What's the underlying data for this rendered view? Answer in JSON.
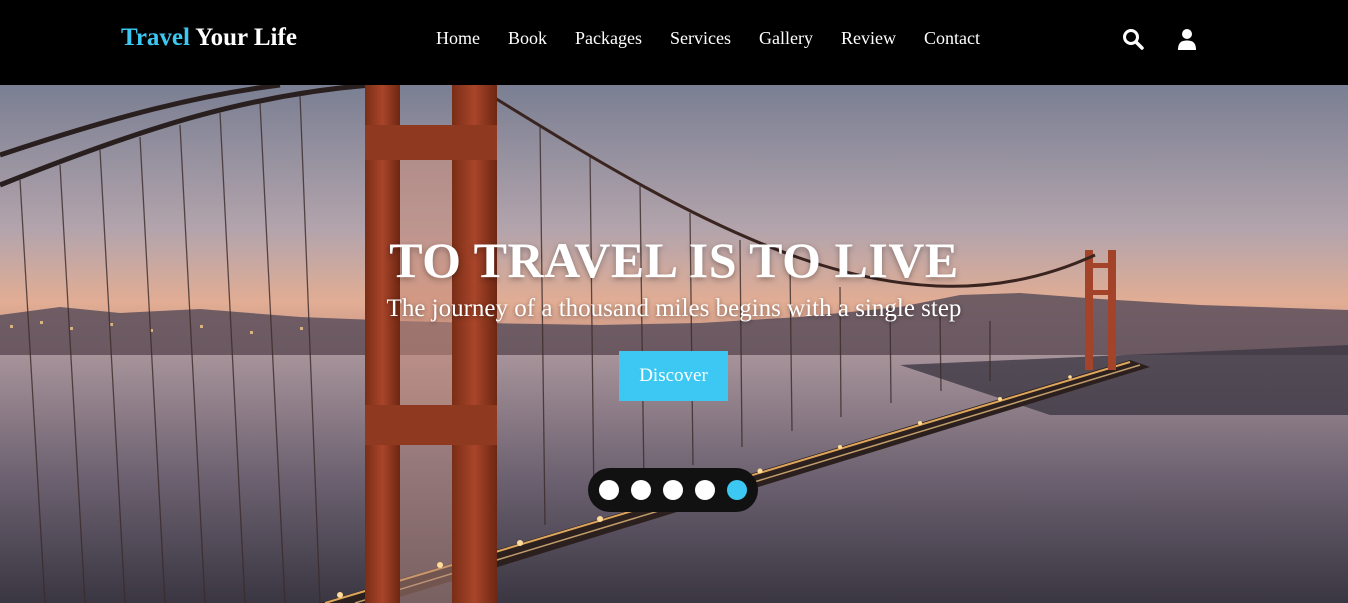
{
  "logo": {
    "part1": "Travel",
    "part2": "Your Life"
  },
  "nav": {
    "links": [
      "Home",
      "Book",
      "Packages",
      "Services",
      "Gallery",
      "Review",
      "Contact"
    ],
    "icons": [
      "search-icon",
      "user-icon"
    ]
  },
  "hero": {
    "title": "TO TRAVEL IS TO LIVE",
    "subtitle": "The journey of a thousand miles begins with a single step",
    "button_label": "Discover"
  },
  "slider": {
    "dot_count": 5,
    "active_index": 4
  },
  "colors": {
    "accent": "#3cc8f2",
    "navbar_bg": "#000000",
    "dots_bg": "#111111"
  }
}
